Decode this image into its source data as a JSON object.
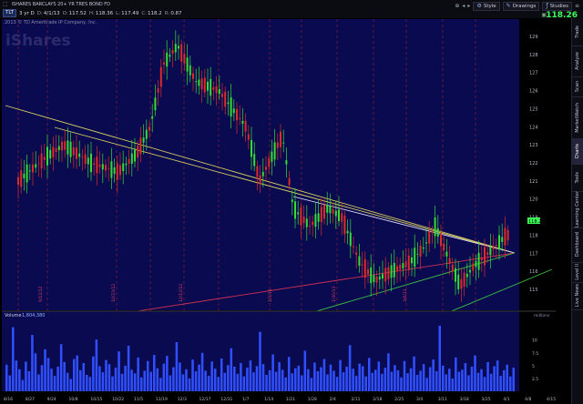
{
  "app": {
    "title": "iSHARES BARCLAYS 20+ YR TRES BOND FD",
    "symbol": "TLT",
    "timeframe": "3 yr D",
    "ohlc": [
      {
        "label": "D:",
        "value": "4/1/13"
      },
      {
        "label": "O:",
        "value": "117.52"
      },
      {
        "label": "H:",
        "value": "118.36"
      },
      {
        "label": "L:",
        "value": "117.49"
      },
      {
        "label": "C:",
        "value": "118.2"
      },
      {
        "label": "R:",
        "value": "0.87"
      }
    ],
    "last_price": "118.26",
    "watermark": "iShares",
    "copyright": "2013 © TD Ameritrade IP Company, Inc."
  },
  "toolbar": {
    "style_label": "Style",
    "drawings_label": "Drawings",
    "studies_label": "Studies"
  },
  "tabs": [
    {
      "label": "Trade",
      "active": false
    },
    {
      "label": "Analyze",
      "active": false
    },
    {
      "label": "Scan",
      "active": false
    },
    {
      "label": "MarketWatch",
      "active": false
    },
    {
      "label": "Charts",
      "active": true
    },
    {
      "label": "Tools",
      "active": false
    },
    {
      "label": "Learning Center",
      "active": false
    },
    {
      "label": "Dashboard",
      "active": false
    },
    {
      "label": "Level II",
      "active": false
    },
    {
      "label": "Live News",
      "active": false
    }
  ],
  "volume_panel": {
    "label": "Volume",
    "value": "1,804,380",
    "unit_label": "millions",
    "axis": [
      "10",
      "7.5",
      "5",
      "2.5"
    ]
  },
  "chart_data": {
    "type": "candlestick",
    "y_axis_ticks": [
      "129",
      "128",
      "127",
      "126",
      "125",
      "124",
      "123",
      "122",
      "121",
      "120",
      "119",
      "118",
      "117",
      "116",
      "115"
    ],
    "ylim": [
      114.4,
      129.4
    ],
    "x_ticks": [
      "8/16",
      "8/27",
      "9/24",
      "10/8",
      "10/15",
      "10/22",
      "11/5",
      "11/19",
      "12/3",
      "12/17",
      "12/31",
      "1/7",
      "1/14",
      "1/21",
      "1/28",
      "2/4",
      "2/11",
      "2/18",
      "2/25",
      "3/4",
      "3/11",
      "3/18",
      "3/25",
      "4/1",
      "4/8",
      "4/15"
    ],
    "event_labels": [
      "9/12/12",
      "10/23/12",
      "12/12/12",
      "1/3/13",
      "1/30/13",
      "3/6/13"
    ],
    "price_badge": "118.2",
    "volume_millions": [
      5.2,
      3.1,
      12.5,
      6.0,
      4.3,
      2.2,
      5.8,
      3.9,
      11.0,
      7.4,
      3.3,
      5.1,
      8.2,
      6.5,
      4.4,
      3.0,
      4.8,
      9.2,
      5.7,
      3.6,
      2.4,
      6.3,
      7.0,
      4.1,
      5.5,
      3.2,
      2.8,
      6.8,
      10.1,
      4.9,
      3.7,
      6.1,
      5.3,
      2.9,
      4.6,
      7.8,
      3.4,
      5.0,
      8.9,
      4.2,
      3.5,
      6.6,
      2.7,
      4.0,
      5.9,
      3.8,
      7.1,
      4.5,
      2.6,
      5.4,
      6.9,
      3.1,
      4.7,
      9.6,
      5.6,
      3.3,
      4.3,
      2.5,
      6.2,
      3.9,
      5.2,
      7.5,
      4.0,
      3.0,
      5.8,
      4.4,
      2.8,
      6.4,
      3.6,
      5.1,
      8.4,
      4.8,
      3.4,
      5.5,
      2.9,
      4.6,
      6.0,
      3.7,
      4.9,
      11.6,
      5.3,
      3.2,
      4.1,
      7.2,
      3.8,
      5.7,
      4.2,
      2.7,
      6.7,
      3.5,
      4.5,
      5.0,
      3.1,
      7.9,
      4.3,
      2.6,
      5.6,
      3.9,
      4.7,
      6.3,
      3.3,
      5.2,
      4.0,
      2.8,
      6.1,
      3.7,
      4.8,
      9.0,
      4.4,
      3.0,
      5.4,
      4.9,
      2.9,
      6.5,
      3.6,
      4.2,
      5.8,
      3.4,
      4.6,
      7.4,
      3.8,
      5.1,
      4.1,
      2.7,
      5.9,
      3.5,
      4.5,
      6.8,
      3.2,
      4.0,
      5.3,
      2.6,
      4.7,
      6.2,
      3.9,
      12.8,
      5.0,
      3.3,
      4.4,
      2.5,
      6.6,
      3.8,
      4.2,
      5.5,
      3.1,
      4.8,
      7.0,
      3.6,
      4.3,
      2.8,
      5.7,
      3.4,
      4.9,
      6.0,
      3.0,
      4.1,
      5.2,
      2.9,
      4.6
    ]
  }
}
